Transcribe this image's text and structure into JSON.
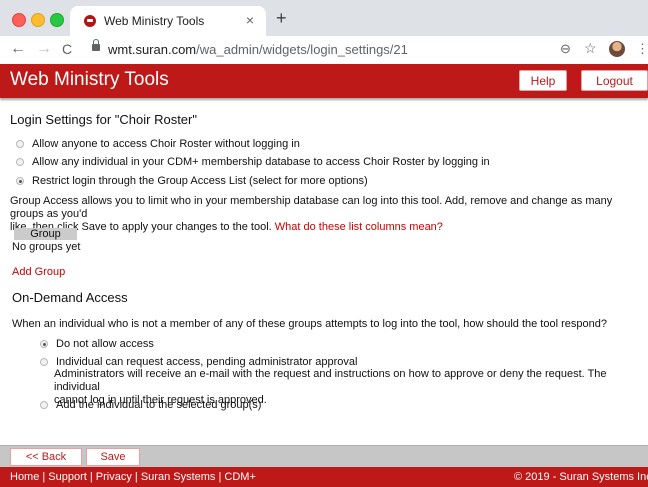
{
  "browser": {
    "tab_title": "Web Ministry Tools",
    "tab_close": "×",
    "new_tab": "+",
    "url_host": "wmt.suran.com",
    "url_path": "/wa_admin/widgets/login_settings/21",
    "back_glyph": "←",
    "forward_glyph": "→",
    "reload_glyph": "C",
    "zoom_glyph": "⊖",
    "star_glyph": "☆",
    "menu_glyph": "⋮"
  },
  "header": {
    "title": "Web Ministry Tools",
    "help_label": "Help",
    "logout_label": "Logout",
    "brand_color": "#be1919"
  },
  "main": {
    "heading": "Login Settings for \"Choir Roster\"",
    "login_options": [
      {
        "label": "Allow anyone to access Choir Roster without logging in",
        "selected": false
      },
      {
        "label": "Allow any individual in your CDM+ membership database to access Choir Roster by logging in",
        "selected": false
      },
      {
        "label": "Restrict login through the Group Access List (select for more options)",
        "selected": true
      }
    ],
    "group_paragraph_line1": "Group Access allows you to limit who in your membership database can log into this tool. Add, remove and change as many groups as you'd",
    "group_paragraph_line2": "like, then click Save to apply your changes to the tool.",
    "columns_link": "What do these list columns mean?",
    "group_table_header": "Group",
    "group_table_empty": "No groups yet",
    "add_group_link": "Add Group",
    "on_demand_heading": "On-Demand Access",
    "on_demand_question": "When an individual who is not a member of any of these groups attempts to log into the tool, how should the tool respond?",
    "on_demand_options": [
      {
        "label": "Do not allow access",
        "selected": true
      },
      {
        "label": "Individual can request access, pending administrator approval",
        "selected": false,
        "detail_line1": "Administrators will receive an e-mail with the request and instructions on how to approve or deny the request. The individual",
        "detail_line2": "cannot log in until their request is approved."
      },
      {
        "label": "Add the individual to the selected group(s)",
        "selected": false
      }
    ]
  },
  "bottom": {
    "back_label": "<< Back",
    "save_label": "Save"
  },
  "footer": {
    "links": "Home | Support | Privacy | Suran Systems | CDM+",
    "copyright": "© 2019 - Suran Systems Inc."
  }
}
